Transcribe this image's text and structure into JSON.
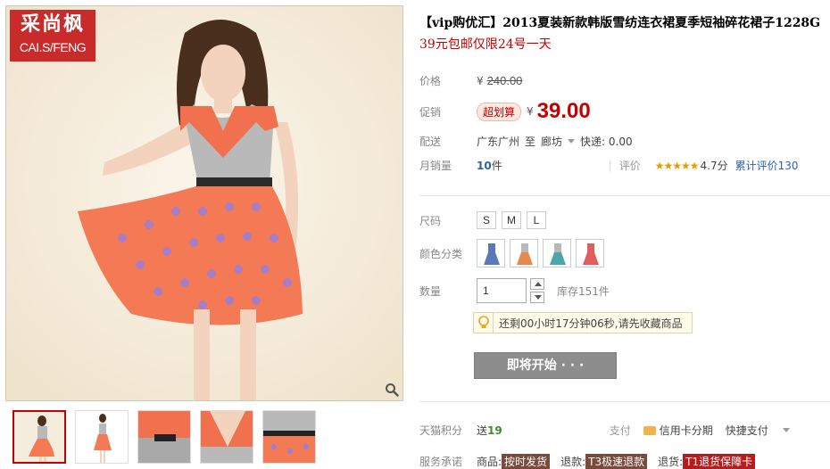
{
  "brand": {
    "cn": "采尚枫",
    "en": "CAI.S/FENG"
  },
  "product": {
    "title": "【vip购优汇】2013夏装新款韩版雪纺连衣裙夏季短袖碎花裙子1228G",
    "subtitle": "39元包邮仅限24号一天"
  },
  "price": {
    "label": "价格",
    "currency": "¥",
    "original": "240.00",
    "promo_label": "促销",
    "promo_badge": "超划算",
    "promo_price": "39.00"
  },
  "shipping": {
    "label": "配送",
    "from": "广东广州",
    "to_word": "至",
    "dest": "廊坊",
    "express": "快递: 0.00"
  },
  "sales": {
    "label": "月销量",
    "count": "10",
    "unit": "件",
    "rating_label": "评价",
    "stars": "★★★★★",
    "rating_value": "4.7分",
    "total_reviews": "累计评价130"
  },
  "size": {
    "label": "尺码",
    "options": [
      "S",
      "M",
      "L"
    ]
  },
  "color": {
    "label": "颜色分类",
    "swatches": [
      "#5a79b8",
      "#e58a4a",
      "#4aa6a8",
      "#e05e5e"
    ]
  },
  "qty": {
    "label": "数量",
    "value": "1",
    "stock": "库存151件"
  },
  "notice": "还剩00小时17分钟06秒,请先收藏商品",
  "start_button": "即将开始 · · ·",
  "points": {
    "label": "天猫积分",
    "give": "送",
    "value": "19",
    "pay_label": "支付",
    "credit": "信用卡分期",
    "quick": "快捷支付"
  },
  "promise": {
    "label": "服务承诺",
    "goods": "商品:",
    "goods_tag": "按时发货",
    "refund": "退款:",
    "refund_tag": "T3极速退款",
    "returns": "退货:",
    "returns_tag": "T1退货保障卡"
  },
  "colors": {
    "accent": "#c40000",
    "button": "#8d8d8d",
    "logo": "#c92a2a"
  },
  "icons": {
    "zoom": "magnifier-icon",
    "bulb": "lightbulb-icon",
    "card": "credit-card-icon"
  }
}
